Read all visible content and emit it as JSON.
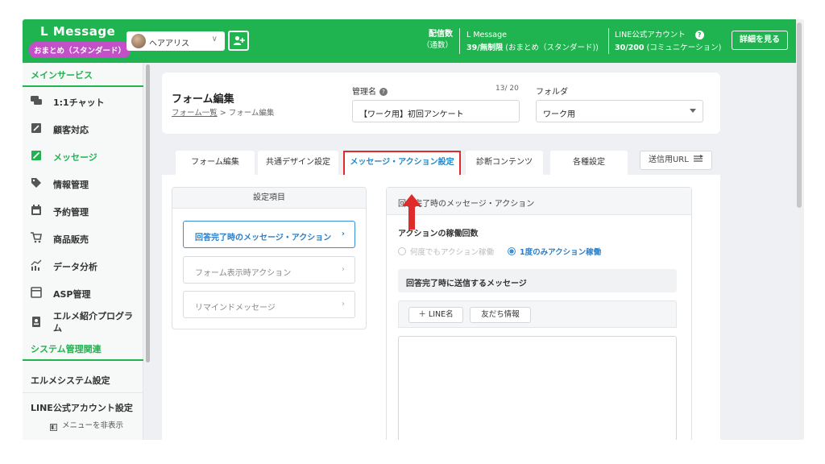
{
  "app": {
    "brand": "L Message",
    "plan_badge": "おまとめ（スタンダード）",
    "account_name": "ヘアアリス",
    "account_chevron": "∨"
  },
  "header": {
    "stat_label_1": "配信数",
    "stat_label_2": "（通数）",
    "msg_label": "L Message",
    "msg_value": "39/無制限",
    "msg_plan": "(おまとめ（スタンダード))",
    "line_label": "LINE公式アカウント",
    "line_value": "30/200",
    "line_plan": "(コミュニケーション)",
    "help_glyph": "?",
    "detail_button": "詳細を見る"
  },
  "sidebar": {
    "section_main": "メインサービス",
    "items": [
      {
        "label": "1:1チャット",
        "icon": "chat-icon"
      },
      {
        "label": "顧客対応",
        "icon": "customer-icon"
      },
      {
        "label": "メッセージ",
        "icon": "message-icon",
        "active": true
      },
      {
        "label": "情報管理",
        "icon": "tag-icon"
      },
      {
        "label": "予約管理",
        "icon": "calendar-icon"
      },
      {
        "label": "商品販売",
        "icon": "cart-icon"
      },
      {
        "label": "データ分析",
        "icon": "chart-icon"
      },
      {
        "label": "ASP管理",
        "icon": "asp-icon"
      },
      {
        "label": "エルメ紹介プログラム",
        "icon": "badge-icon"
      }
    ],
    "section_system": "システム管理関連",
    "system_settings": "エルメシステム設定",
    "line_settings": "LINE公式アカウント設定",
    "hide_menu": "メニューを非表示",
    "hide_menu_glyph": "◧"
  },
  "form": {
    "page_title": "フォーム編集",
    "breadcrumb_link": "フォーム一覧",
    "breadcrumb_sep": " > ",
    "breadcrumb_current": "フォーム編集",
    "name_label": "管理名",
    "name_help": "?",
    "char_count": "13/ 20",
    "name_value": "【ワーク用】初回アンケート",
    "folder_label": "フォルダ",
    "folder_value": "ワーク用"
  },
  "tabs": [
    {
      "label": "フォーム編集"
    },
    {
      "label": "共通デザイン設定"
    },
    {
      "label": "メッセージ・アクション設定",
      "active": true
    },
    {
      "label": "診断コンテンツ"
    },
    {
      "label": "各種設定"
    }
  ],
  "url_button": "送信用URL",
  "url_icon": "send-icon",
  "settings": {
    "header": "設定項目",
    "items": [
      {
        "label": "回答完了時のメッセージ・アクション",
        "active": true
      },
      {
        "label": "フォーム表示時アクション"
      },
      {
        "label": "リマインドメッセージ"
      }
    ],
    "arrow": "›"
  },
  "action": {
    "header": "回答完了時のメッセージ・アクション",
    "frequency_label": "アクションの稼働回数",
    "option_every": "何度でもアクション稼働",
    "option_once": "1度のみアクション稼働",
    "message_header": "回答完了時に送信するメッセージ",
    "insert_line_name": "＋ LINE名",
    "insert_friend_info": "友だち情報"
  },
  "colors": {
    "brand_green": "#1fb44f",
    "badge_purple": "#c34fc9",
    "active_blue": "#1e88c8",
    "highlight_red": "#e02b2b"
  }
}
